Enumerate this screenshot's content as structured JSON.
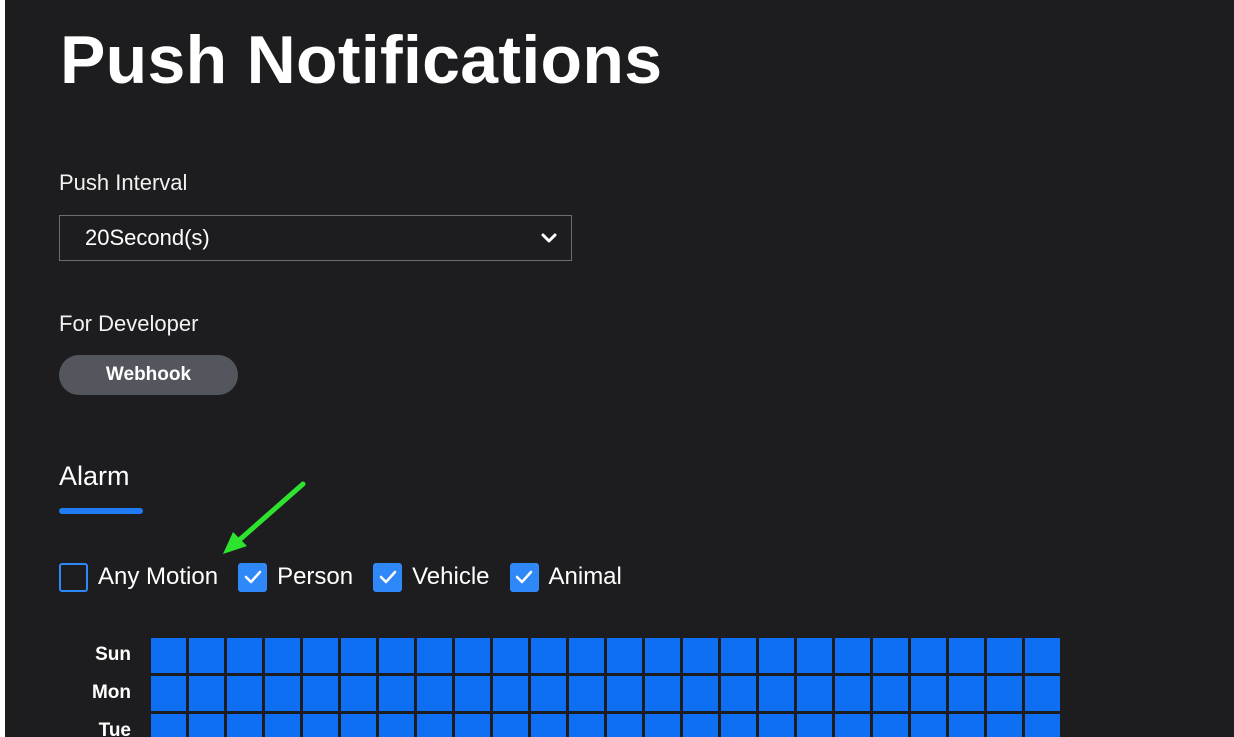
{
  "page_title": "Push Notifications",
  "push_interval": {
    "label": "Push Interval",
    "selected_value": "20Second(s)"
  },
  "developer": {
    "label": "For Developer",
    "webhook_button": "Webhook"
  },
  "alarm_tab": {
    "label": "Alarm"
  },
  "detection_types": [
    {
      "label": "Any Motion",
      "checked": false
    },
    {
      "label": "Person",
      "checked": true
    },
    {
      "label": "Vehicle",
      "checked": true
    },
    {
      "label": "Animal",
      "checked": true
    }
  ],
  "schedule": {
    "days": [
      "Sun",
      "Mon",
      "Tue"
    ],
    "hours_per_day": 24,
    "active_color": "#0f6ff2"
  },
  "colors": {
    "background": "#1d1d1f",
    "accent": "#1f7cf5",
    "annotation_arrow": "#2ee32e"
  }
}
